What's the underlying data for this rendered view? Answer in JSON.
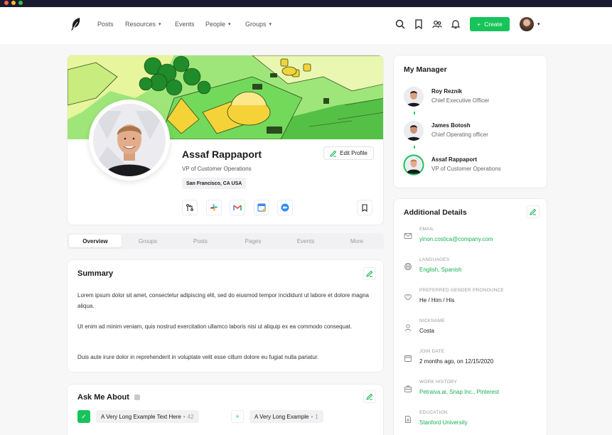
{
  "nav": {
    "items": [
      {
        "label": "Posts",
        "dropdown": false
      },
      {
        "label": "Resources",
        "dropdown": true
      },
      {
        "label": "Events",
        "dropdown": false
      },
      {
        "label": "People",
        "dropdown": true
      },
      {
        "label": "Groups",
        "dropdown": true
      }
    ],
    "create_label": "Create"
  },
  "profile": {
    "name": "Assaf Rappaport",
    "title": "VP of Customer Operations",
    "location": "San Francisco, CA USA",
    "edit_label": "Edit Profile",
    "apps": [
      "merge-icon",
      "slack-icon",
      "gmail-icon",
      "google-calendar-icon",
      "zoom-icon"
    ]
  },
  "tabs": [
    "Overview",
    "Groups",
    "Posts",
    "Pages",
    "Events",
    "More"
  ],
  "summary": {
    "title": "Summary",
    "paragraphs": [
      "Lorem ipsum dolor sit amet, consectetur adipiscing elit, sed do eiusmod tempor incididunt ut labore et dolore magna aliqua.",
      "Ut enim ad minim veniam, quis nostrud exercitation ullamco laboris nisi ut aliquip ex ea commodo consequat.",
      "Duis aute irure dolor in reprehenderit in voluptate velit esse cillum dolore eu fugiat nulla pariatur."
    ]
  },
  "ask": {
    "title": "Ask Me About",
    "items": [
      {
        "label": "A Very Long Example Text Here",
        "count": "42",
        "checked": true
      },
      {
        "label": "A Very Long Example",
        "count": "1",
        "checked": false
      }
    ]
  },
  "manager": {
    "title": "My Manager",
    "people": [
      {
        "name": "Roy Reznik",
        "role": "Chief Executive Officer"
      },
      {
        "name": "James Botosh",
        "role": "Chief Operating officer"
      },
      {
        "name": "Assaf Rappaport",
        "role": "VP of Customer Operations"
      }
    ]
  },
  "details": {
    "title": "Additional Details",
    "items": [
      {
        "label": "EMAIL",
        "value": "yinon.costica@company.com",
        "icon": "mail-icon",
        "accent": true
      },
      {
        "label": "LANGUAGES",
        "value": "English, Spanish",
        "icon": "globe-icon",
        "accent": true
      },
      {
        "label": "PREFERRED GENDER PRONOUNCE",
        "value": "He / Him / His",
        "icon": "heart-icon",
        "accent": false
      },
      {
        "label": "NICKNAME",
        "value": "Costa",
        "icon": "user-icon",
        "accent": false
      },
      {
        "label": "JOIN DATE",
        "value": "2 months ago, on 12/15/2020",
        "icon": "calendar-icon",
        "accent": false
      },
      {
        "label": "WORK HISTORY",
        "value": "Petraiva.ai, Snap Inc., Pinterest",
        "icon": "briefcase-icon",
        "accent": true
      },
      {
        "label": "EDUCATION",
        "value": "Stanford University",
        "icon": "document-icon",
        "accent": true
      }
    ]
  },
  "colors": {
    "accent": "#16c45a",
    "banner": "#8fe06d"
  }
}
